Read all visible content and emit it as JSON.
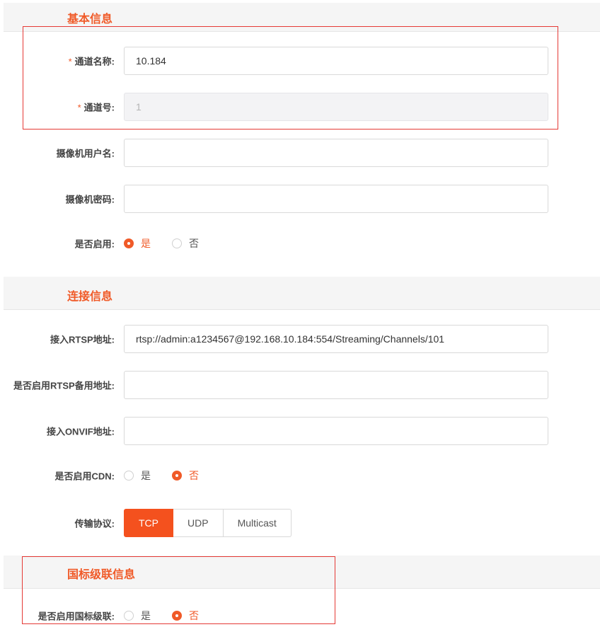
{
  "basic": {
    "title": "基本信息",
    "channel_name": {
      "label": "通道名称:",
      "required_mark": "*",
      "value": "10.184"
    },
    "channel_no": {
      "label": "通道号:",
      "required_mark": "*",
      "value": "1"
    },
    "camera_user": {
      "label": "摄像机用户名:",
      "value": ""
    },
    "camera_pwd": {
      "label": "摄像机密码:",
      "value": ""
    },
    "enabled": {
      "label": "是否启用:",
      "yes": "是",
      "no": "否",
      "selected": "yes"
    }
  },
  "connection": {
    "title": "连接信息",
    "rtsp": {
      "label": "接入RTSP地址:",
      "value": "rtsp://admin:a1234567@192.168.10.184:554/Streaming/Channels/101"
    },
    "rtsp_backup": {
      "label": "是否启用RTSP备用地址:",
      "value": ""
    },
    "onvif": {
      "label": "接入ONVIF地址:",
      "value": ""
    },
    "cdn": {
      "label": "是否启用CDN:",
      "yes": "是",
      "no": "否",
      "selected": "no"
    },
    "protocol": {
      "label": "传输协议:",
      "options": [
        "TCP",
        "UDP",
        "Multicast"
      ],
      "selected": "TCP"
    }
  },
  "gb": {
    "title": "国标级联信息",
    "cascade": {
      "label": "是否启用国标级联:",
      "yes": "是",
      "no": "否",
      "selected": "no"
    }
  },
  "colors": {
    "accent": "#f05a28",
    "highlight_box": "#e53935"
  }
}
